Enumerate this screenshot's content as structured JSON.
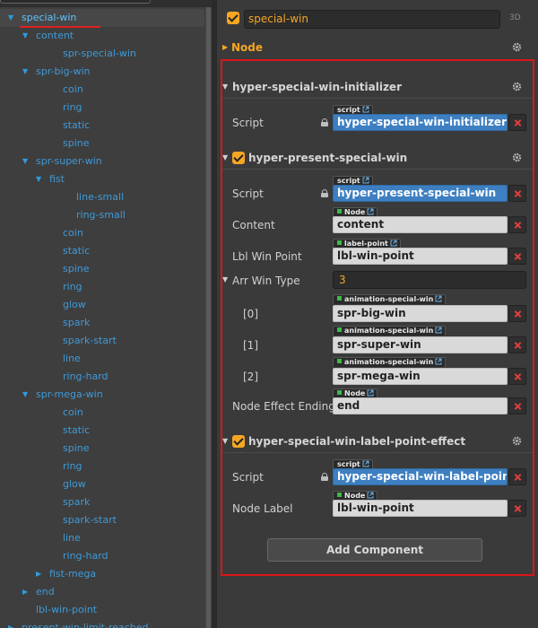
{
  "hierarchy": {
    "nodes": [
      {
        "label": "special-win",
        "arrow": "▼"
      },
      {
        "label": "content",
        "arrow": "▼"
      },
      {
        "label": "spr-special-win",
        "arrow": ""
      },
      {
        "label": "spr-big-win",
        "arrow": "▼"
      },
      {
        "label": "coin",
        "arrow": ""
      },
      {
        "label": "ring",
        "arrow": ""
      },
      {
        "label": "static",
        "arrow": ""
      },
      {
        "label": "spine",
        "arrow": ""
      },
      {
        "label": "spr-super-win",
        "arrow": "▼"
      },
      {
        "label": "fist",
        "arrow": "▼"
      },
      {
        "label": "line-small",
        "arrow": ""
      },
      {
        "label": "ring-small",
        "arrow": ""
      },
      {
        "label": "coin",
        "arrow": ""
      },
      {
        "label": "static",
        "arrow": ""
      },
      {
        "label": "spine",
        "arrow": ""
      },
      {
        "label": "ring",
        "arrow": ""
      },
      {
        "label": "glow",
        "arrow": ""
      },
      {
        "label": "spark",
        "arrow": ""
      },
      {
        "label": "spark-start",
        "arrow": ""
      },
      {
        "label": "line",
        "arrow": ""
      },
      {
        "label": "ring-hard",
        "arrow": ""
      },
      {
        "label": "spr-mega-win",
        "arrow": "▼"
      },
      {
        "label": "coin",
        "arrow": ""
      },
      {
        "label": "static",
        "arrow": ""
      },
      {
        "label": "spine",
        "arrow": ""
      },
      {
        "label": "ring",
        "arrow": ""
      },
      {
        "label": "glow",
        "arrow": ""
      },
      {
        "label": "spark",
        "arrow": ""
      },
      {
        "label": "spark-start",
        "arrow": ""
      },
      {
        "label": "line",
        "arrow": ""
      },
      {
        "label": "ring-hard",
        "arrow": ""
      },
      {
        "label": "fist-mega",
        "arrow": "▶"
      },
      {
        "label": "end",
        "arrow": "▶"
      },
      {
        "label": "lbl-win-point",
        "arrow": ""
      },
      {
        "label": "present-win-limit-reached",
        "arrow": "▶"
      }
    ]
  },
  "inspector": {
    "node_name": "special-win",
    "node_3d_label": "3D",
    "node_section_title": "Node",
    "components": {
      "initializer": {
        "title": "hyper-special-win-initializer",
        "script_label": "Script",
        "script_tag": "script",
        "script_value": "hyper-special-win-initializer"
      },
      "present": {
        "title": "hyper-present-special-win",
        "script_label": "Script",
        "script_tag": "script",
        "script_value": "hyper-present-special-win",
        "content_label": "Content",
        "content_tag": "Node",
        "content_value": "content",
        "lbl_win_point_label": "Lbl Win Point",
        "lbl_win_point_tag": "label-point",
        "lbl_win_point_value": "lbl-win-point",
        "arr_win_type_label": "Arr Win Type",
        "arr_win_type_count": "3",
        "arr_items": [
          {
            "index": "[0]",
            "tag": "animation-special-win",
            "value": "spr-big-win"
          },
          {
            "index": "[1]",
            "tag": "animation-special-win",
            "value": "spr-super-win"
          },
          {
            "index": "[2]",
            "tag": "animation-special-win",
            "value": "spr-mega-win"
          }
        ],
        "node_effect_label": "Node Effect Ending",
        "node_effect_tag": "Node",
        "node_effect_value": "end"
      },
      "label_point_effect": {
        "title": "hyper-special-win-label-point-effect",
        "script_label": "Script",
        "script_tag": "script",
        "script_value": "hyper-special-win-label-point-...",
        "node_label_label": "Node Label",
        "node_label_tag": "Node",
        "node_label_value": "lbl-win-point"
      }
    },
    "add_component_label": "Add Component",
    "colors": {
      "accent_orange": "#f5a623",
      "highlight_red": "#d9161a",
      "script_blue": "#3e7fc1",
      "tree_blue": "#3f9ad8"
    }
  }
}
